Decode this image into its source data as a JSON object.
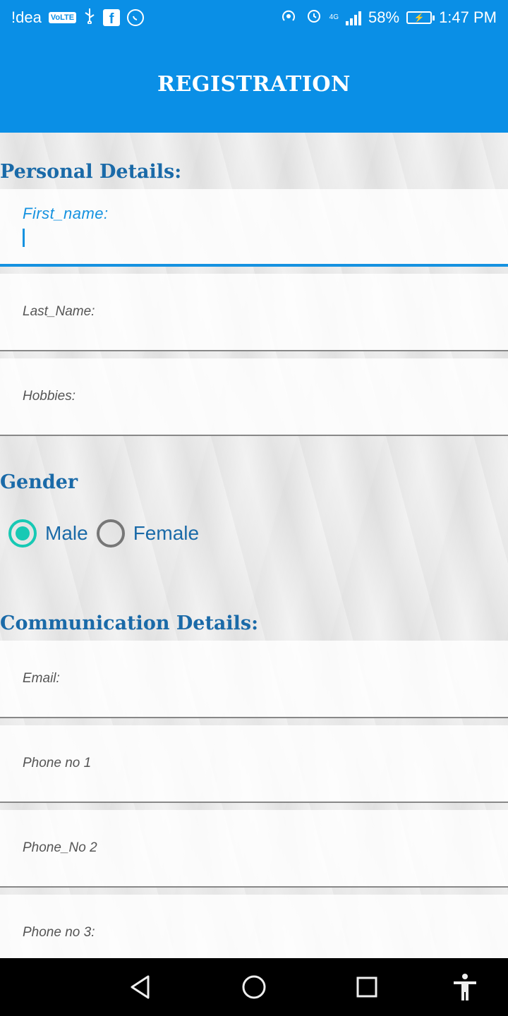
{
  "status_bar": {
    "carrier": "!dea",
    "volte": "VoLTE",
    "network": "4G",
    "battery_percent": "58%",
    "time": "1:47 PM",
    "alarm_badge": "1"
  },
  "app_bar": {
    "title": "REGISTRATION"
  },
  "personal": {
    "title": "Personal Details:",
    "first_name_label": "First_name:",
    "last_name_label": "Last_Name:",
    "hobbies_label": "Hobbies:"
  },
  "gender": {
    "title": "Gender",
    "options": [
      {
        "label": "Male",
        "checked": true
      },
      {
        "label": "Female",
        "checked": false
      }
    ]
  },
  "communication": {
    "title": "Communication Details:",
    "email_label": "Email:",
    "phone1_label": "Phone no 1",
    "phone2_label": "Phone_No 2",
    "phone3_label": "Phone no 3:"
  },
  "colors": {
    "accent": "#0a8fe6",
    "heading": "#1a6aa8",
    "radio_checked": "#17c9b4"
  },
  "icons": {
    "status": [
      "usb-icon",
      "facebook-icon",
      "whatsapp-icon",
      "hotspot-icon",
      "alarm-icon",
      "signal-icon",
      "battery-icon"
    ],
    "nav": [
      "back-icon",
      "home-icon",
      "recents-icon",
      "accessibility-icon"
    ]
  }
}
